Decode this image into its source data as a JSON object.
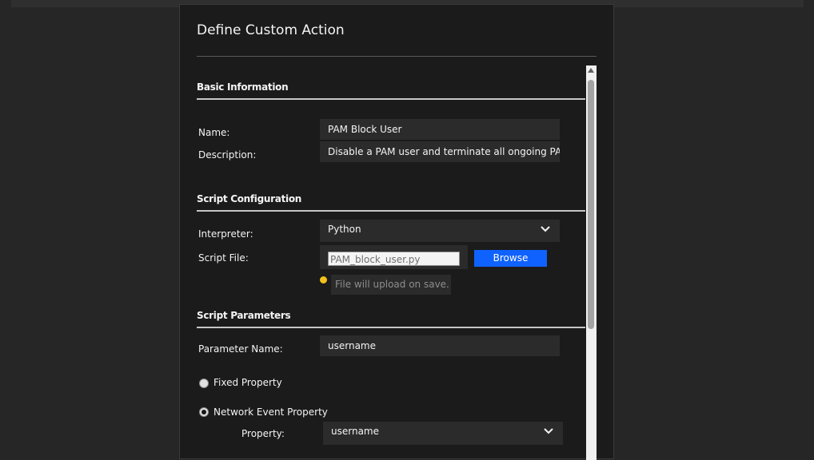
{
  "dialog": {
    "title": "Define Custom Action"
  },
  "basic_info": {
    "heading": "Basic Information",
    "name_label": "Name:",
    "name_value": "PAM Block User",
    "description_label": "Description:",
    "description_value": "Disable a PAM user and terminate all ongoing PAM se"
  },
  "script_config": {
    "heading": "Script Configuration",
    "interpreter_label": "Interpreter:",
    "interpreter_value": "Python",
    "script_file_label": "Script File:",
    "script_file_value": "PAM_block_user.py",
    "browse_label": "Browse",
    "upload_hint": "File will upload on save."
  },
  "script_params": {
    "heading": "Script Parameters",
    "param_name_label": "Parameter Name:",
    "param_name_value": "username",
    "fixed_property_label": "Fixed Property",
    "fixed_property_selected": false,
    "network_event_property_label": "Network Event Property",
    "network_event_property_selected": true,
    "property_label": "Property:",
    "property_value": "username"
  },
  "colors": {
    "background": "#262626",
    "dialog": "#1b1b1b",
    "field": "#2b2b2b",
    "accent_button": "#0f62fe",
    "hint_icon": "#f1c21b"
  },
  "icons": [
    "chevron-down-icon",
    "info-dot-icon",
    "scroll-up-arrow-icon"
  ]
}
